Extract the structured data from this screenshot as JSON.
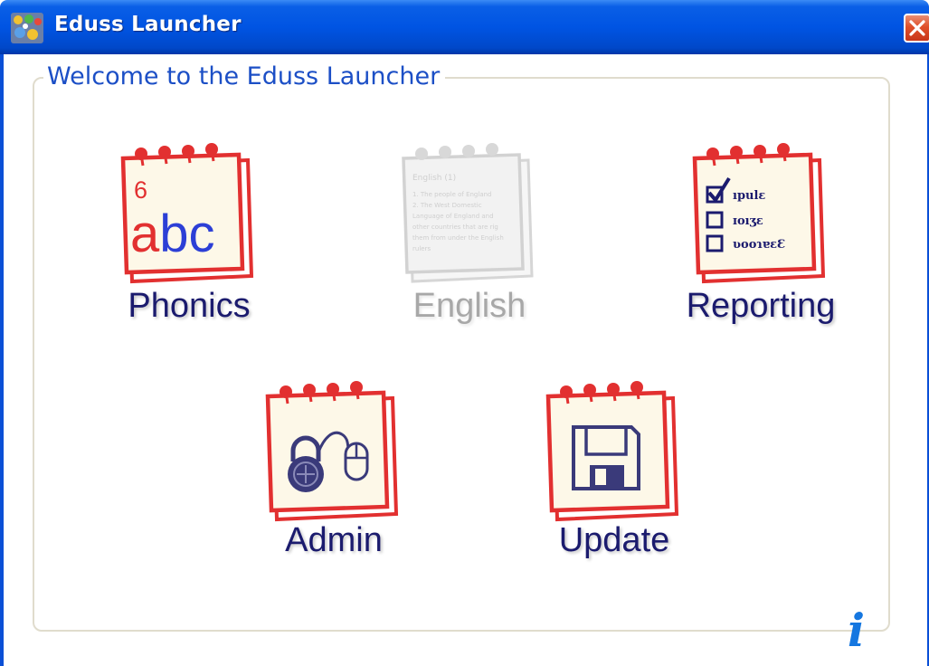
{
  "window": {
    "title": "Eduss Launcher",
    "close_label": "Close"
  },
  "group": {
    "legend": "Welcome to the Eduss Launcher"
  },
  "tiles": {
    "phonics": {
      "label": "Phonics",
      "icon_number": "6",
      "icon_text": "abc",
      "enabled": true
    },
    "english": {
      "label": "English",
      "enabled": false,
      "page_lines": [
        "English (1)",
        "1. The people of England",
        "2. The West Domestic",
        "Language of England and",
        "other countries that are rig",
        "them from under the English",
        "rulers"
      ]
    },
    "reporting": {
      "label": "Reporting",
      "enabled": true,
      "check_items": [
        "ıpulε",
        "ɪoıʒε",
        "ʋooɿɐɛƐ"
      ]
    },
    "admin": {
      "label": "Admin",
      "enabled": true
    },
    "update": {
      "label": "Update",
      "enabled": true
    }
  },
  "info": {
    "glyph": "i"
  },
  "colors": {
    "title_bar": "#0054e3",
    "legend_text": "#1c4fc6",
    "label_text": "#1b1b6e",
    "disabled_text": "#a8a8a8",
    "notepad_red": "#e23030",
    "notepad_paper": "#fdf8e8"
  }
}
